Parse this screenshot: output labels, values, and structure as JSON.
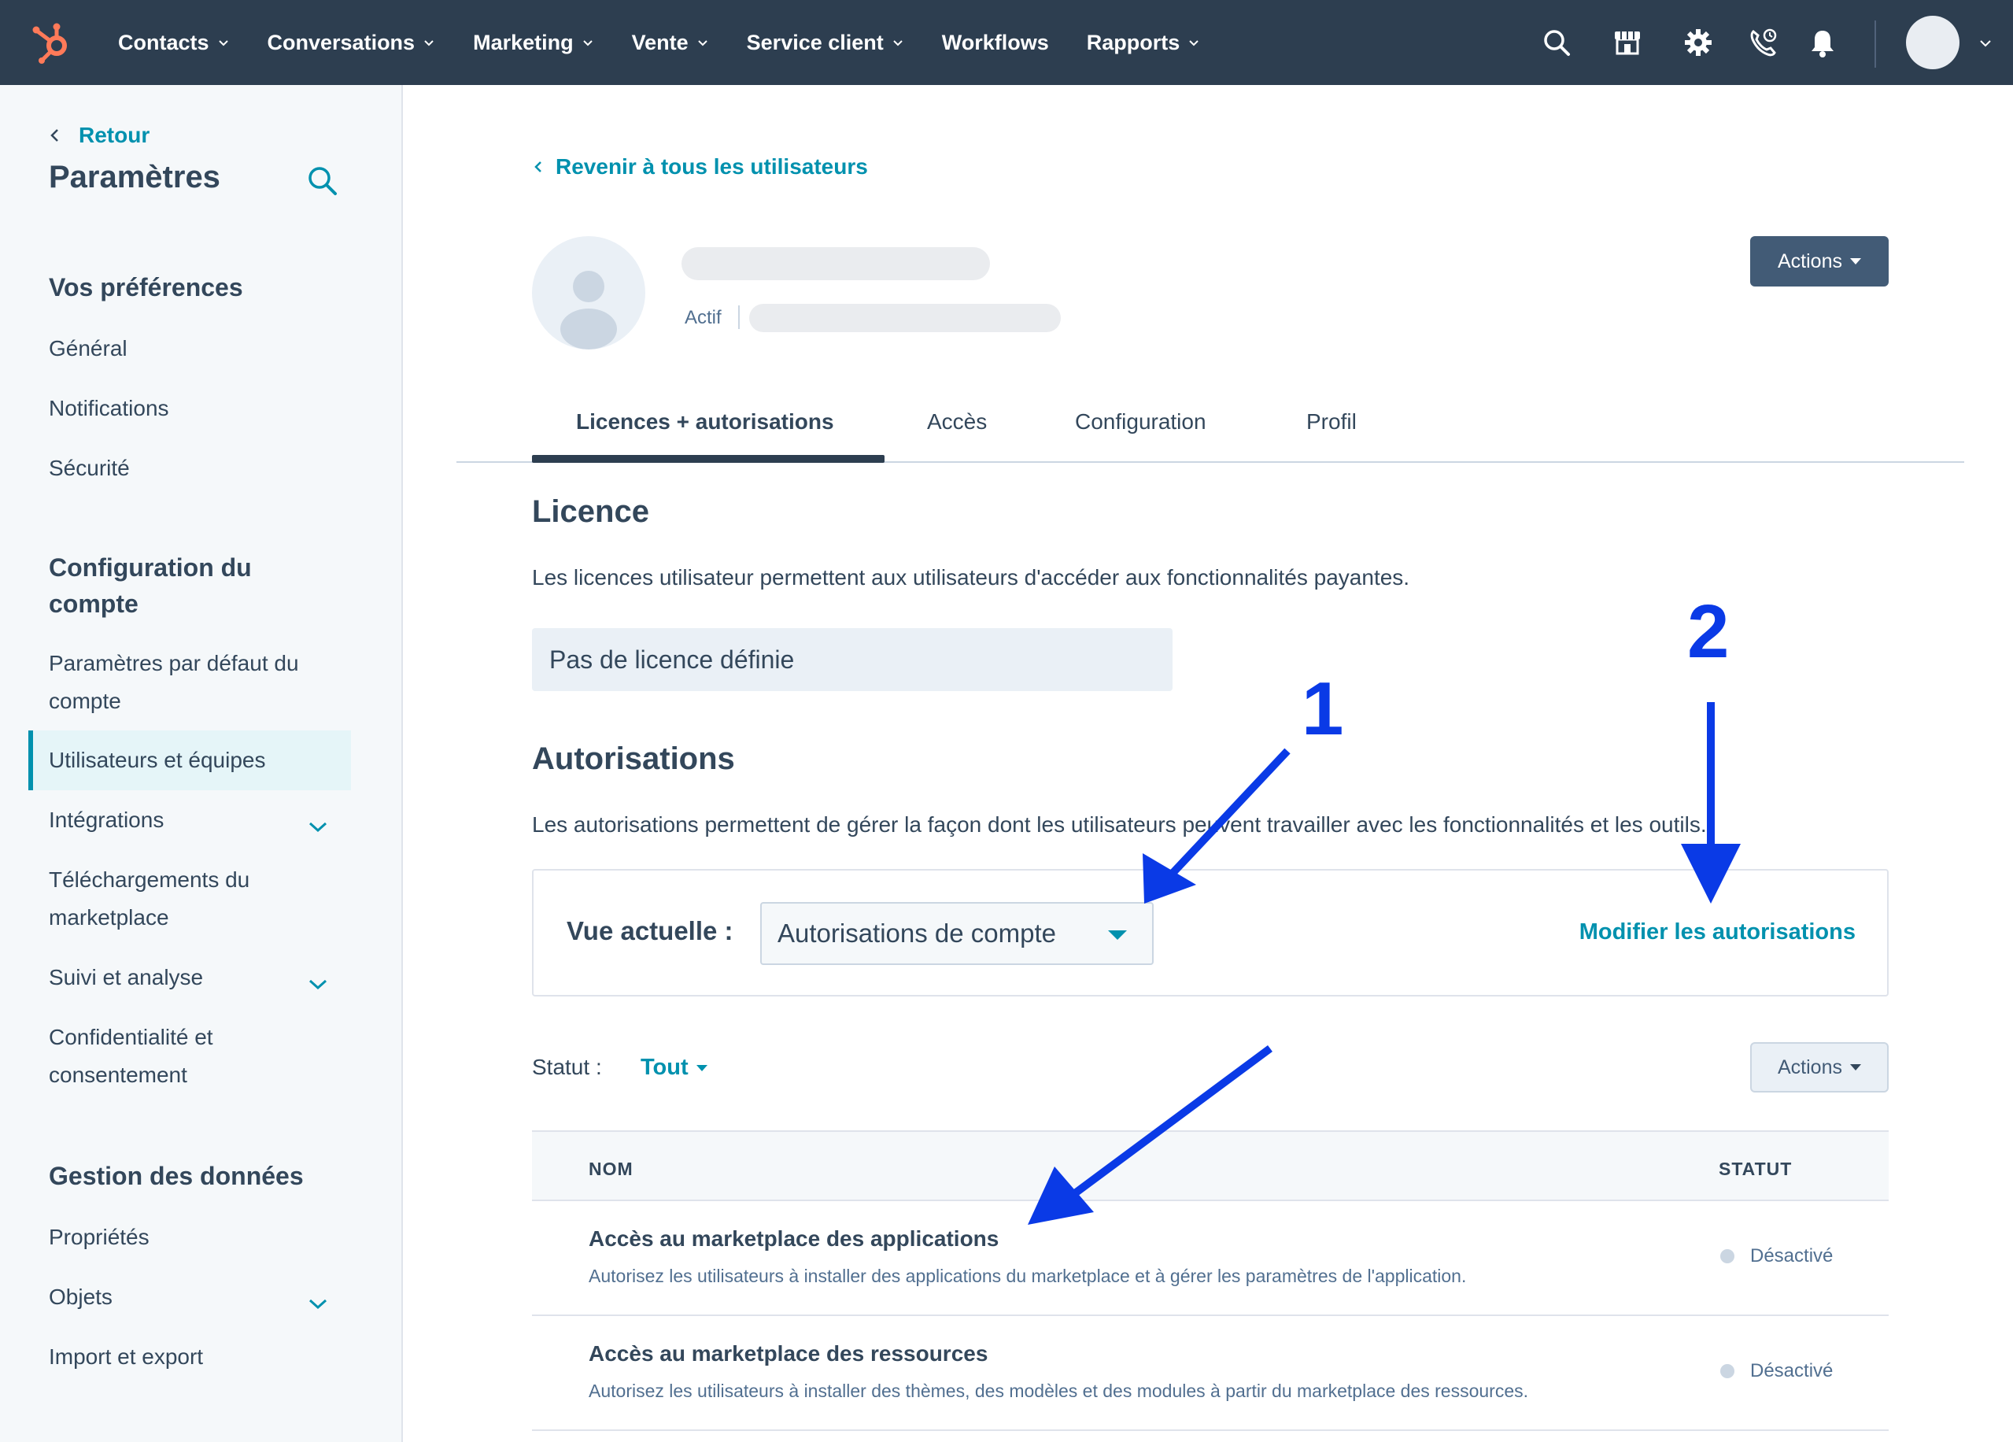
{
  "topnav": {
    "items": [
      {
        "label": "Contacts",
        "has_menu": true
      },
      {
        "label": "Conversations",
        "has_menu": true
      },
      {
        "label": "Marketing",
        "has_menu": true
      },
      {
        "label": "Vente",
        "has_menu": true
      },
      {
        "label": "Service client",
        "has_menu": true
      },
      {
        "label": "Workflows",
        "has_menu": false
      },
      {
        "label": "Rapports",
        "has_menu": true
      }
    ],
    "icons": [
      "search-icon",
      "marketplace-icon",
      "gear-icon",
      "calling-icon",
      "bell-icon"
    ]
  },
  "sidebar": {
    "back_label": "Retour",
    "title": "Paramètres",
    "sections": [
      {
        "heading": "Vos préférences",
        "items": [
          "Général",
          "Notifications",
          "Sécurité"
        ]
      },
      {
        "heading": "Configuration du compte",
        "items": [
          "Paramètres par défaut du compte",
          "Utilisateurs et équipes",
          "Intégrations",
          "Téléchargements du marketplace",
          "Suivi et analyse",
          "Confidentialité et consentement"
        ]
      },
      {
        "heading": "Gestion des données",
        "items": [
          "Propriétés",
          "Objets",
          "Import et export"
        ]
      }
    ],
    "active_item": "Utilisateurs et équipes"
  },
  "main": {
    "back_label": "Revenir à tous les utilisateurs",
    "user_status": "Actif",
    "actions_label": "Actions",
    "tabs": [
      "Licences + autorisations",
      "Accès",
      "Configuration",
      "Profil"
    ],
    "active_tab": "Licences + autorisations",
    "licence": {
      "heading": "Licence",
      "description": "Les licences utilisateur permettent aux utilisateurs d'accéder aux fonctionnalités payantes.",
      "value": "Pas de licence définie"
    },
    "permissions": {
      "heading": "Autorisations",
      "description": "Les autorisations permettent de gérer la façon dont les utilisateurs peuvent travailler avec les fonctionnalités et les outils.",
      "view_label": "Vue actuelle :",
      "view_value": "Autorisations de compte",
      "edit_link": "Modifier les autorisations"
    },
    "filter": {
      "label": "Statut :",
      "value": "Tout",
      "actions_label": "Actions"
    },
    "table": {
      "columns": [
        "NOM",
        "STATUT"
      ],
      "rows": [
        {
          "title": "Accès au marketplace des applications",
          "description": "Autorisez les utilisateurs à installer des applications du marketplace et à gérer les paramètres de l'application.",
          "status": "Désactivé"
        },
        {
          "title": "Accès au marketplace des ressources",
          "description": "Autorisez les utilisateurs à installer des thèmes, des modèles et des modules à partir du marketplace des ressources.",
          "status": "Désactivé"
        }
      ]
    }
  },
  "annotations": {
    "labels": [
      "1",
      "2"
    ],
    "color": "#0a3ae6"
  },
  "colors": {
    "nav_bg": "#2d3e50",
    "accent": "#0091ae",
    "brand_orange": "#ff7a59",
    "sidebar_bg": "#f5f8fa",
    "button_dark": "#425b76"
  }
}
